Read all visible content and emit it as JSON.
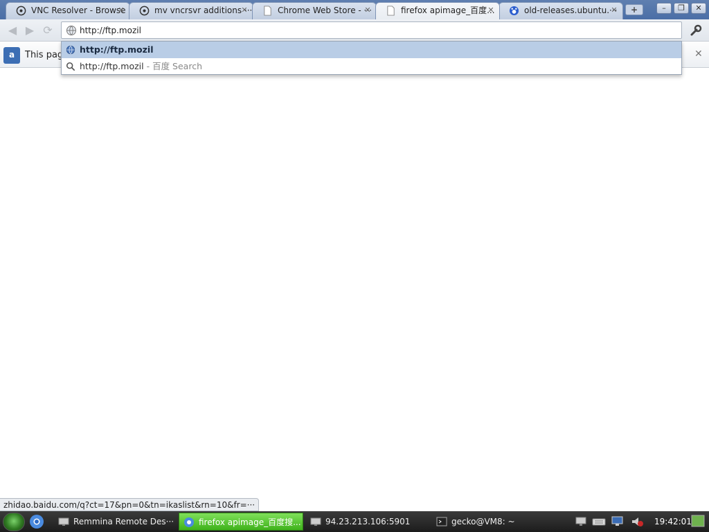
{
  "tabs": [
    {
      "title": "VNC Resolver - Browse",
      "icon": "ubuntu-icon"
    },
    {
      "title": "mv vncrsvr additions ···",
      "icon": "ubuntu-icon"
    },
    {
      "title": "Chrome Web Store - ···",
      "icon": "page-icon"
    },
    {
      "title": "firefox apimage_百度...",
      "icon": "page-icon",
      "active": true
    },
    {
      "title": "old-releases.ubuntu.···",
      "icon": "baidu-icon"
    }
  ],
  "window_controls": {
    "minimize": "–",
    "restore": "❐",
    "close": "✕"
  },
  "new_tab_label": "+",
  "omnibox": {
    "value": "http://ftp.mozil"
  },
  "suggestions": [
    {
      "text": "http://ftp.mozil",
      "hint": "",
      "icon": "globe-icon"
    },
    {
      "text": "http://ftp.mozil",
      "hint": " - 百度 Search",
      "icon": "search-icon"
    }
  ],
  "infobar": {
    "text": "This page",
    "icon_label": "a"
  },
  "status_bubble": "zhidao.baidu.com/q?ct=17&pn=0&tn=ikaslist&rn=10&fr=···",
  "taskbar": {
    "tasks": [
      {
        "label": "Remmina Remote Des···"
      },
      {
        "label": "firefox apimage_百度搜...",
        "active": true
      },
      {
        "label": "94.23.213.106:5901"
      },
      {
        "label": "gecko@VM8: ~"
      }
    ],
    "clock": "19:42:01"
  },
  "colors": {
    "accent": "#4a6ea6",
    "selected_suggestion": "#b9cde6",
    "active_task": "#3fb21b"
  }
}
